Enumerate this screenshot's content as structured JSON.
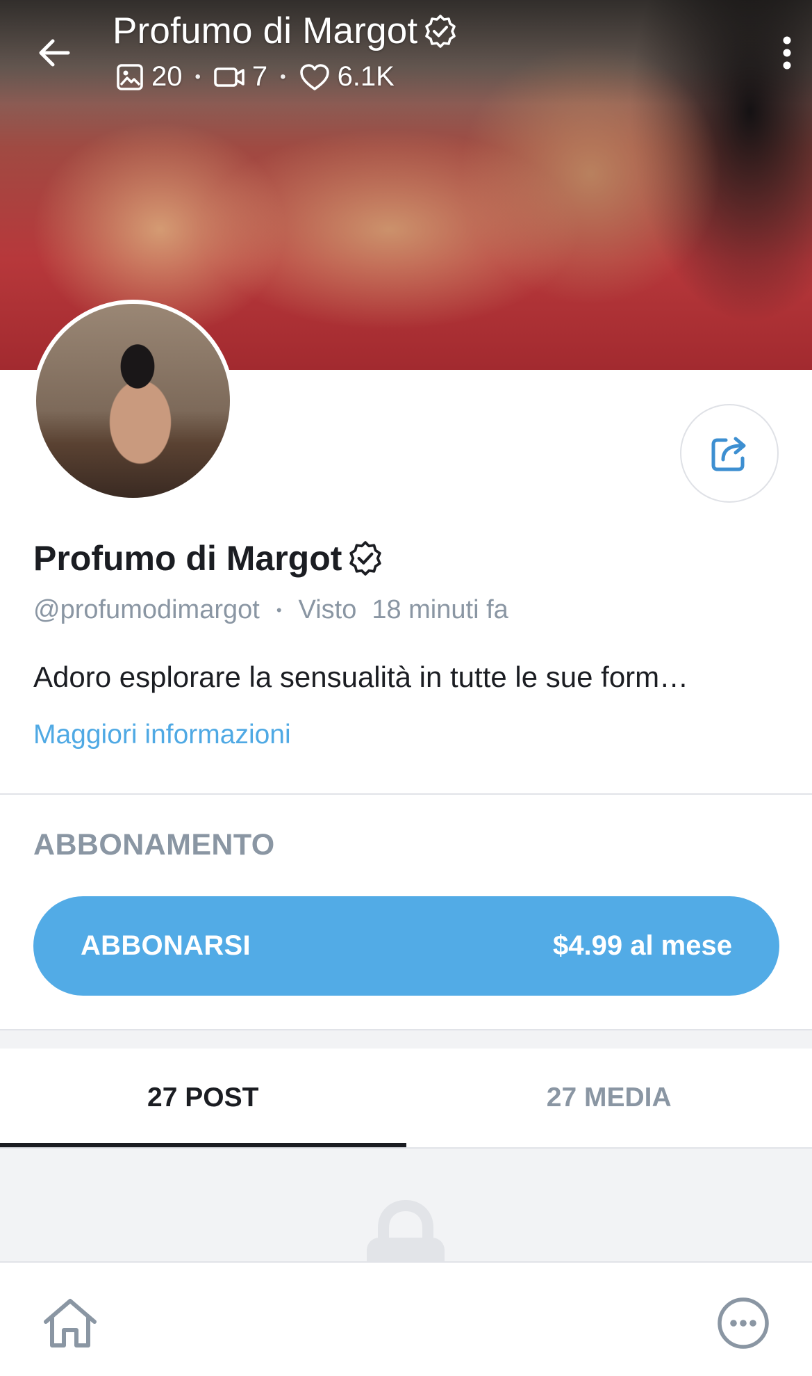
{
  "header": {
    "title": "Profumo di Margot",
    "verified_icon": "verified-badge-icon",
    "stats": {
      "photos": "20",
      "videos": "7",
      "likes": "6.1K"
    },
    "icons": [
      "back-arrow-icon",
      "image-icon",
      "video-camera-icon",
      "heart-icon",
      "more-vertical-icon"
    ]
  },
  "profile": {
    "name": "Profumo di Margot",
    "handle": "@profumodimargot",
    "separator": "•",
    "seen_label": "Visto",
    "seen_time": "18 minuti fa",
    "bio": "Adoro esplorare la sensualità in tutte le sue form…",
    "more_info": "Maggiori informazioni",
    "share_icon": "share-icon"
  },
  "subscription": {
    "heading": "ABBONAMENTO",
    "button_label": "ABBONARSI",
    "price": "$4.99 al mese",
    "accent_color": "#52abe6"
  },
  "tabs": [
    {
      "label": "27 POST",
      "active": true
    },
    {
      "label": "27 MEDIA",
      "active": false
    }
  ],
  "content": {
    "lock_icon": "lock-icon"
  },
  "bottom_nav": {
    "icons": [
      "home-icon",
      "more-horizontal-icon"
    ]
  },
  "colors": {
    "text_primary": "#1b1d22",
    "text_secondary": "#8a96a3",
    "link": "#4fa9e4",
    "divider": "#e1e3e8"
  }
}
